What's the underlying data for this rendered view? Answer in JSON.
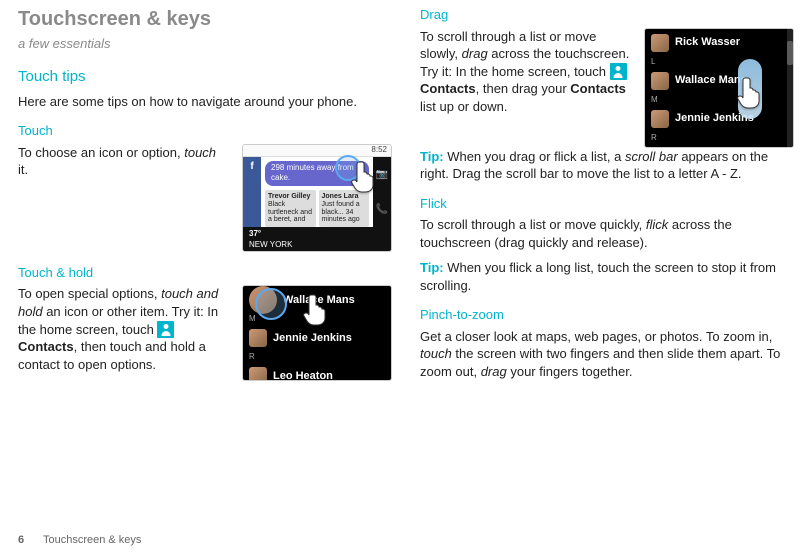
{
  "page_number": "6",
  "footer_title": "Touchscreen & keys",
  "left": {
    "heading": "Touchscreen & keys",
    "subtitle": "a few essentials",
    "touch_tips": {
      "title": "Touch tips",
      "intro": "Here are some tips on how to navigate around your phone."
    },
    "touch": {
      "title": "Touch",
      "p1a": "To choose an icon or option, ",
      "p1b": "touch",
      "p1c": " it."
    },
    "touch_hold": {
      "title": "Touch & hold",
      "p1a": "To open special options, ",
      "p1b": "touch and hold",
      "p1c": " an icon or other item. Try it: In the home screen, touch ",
      "contacts_label": "Contacts",
      "p1d": ", then touch and hold a contact to open options."
    }
  },
  "right": {
    "drag": {
      "title": "Drag",
      "p1a": "To scroll through a list or move slowly, ",
      "p1b": "drag",
      "p1c": " across the touchscreen. Try it: In the home screen, touch ",
      "contacts_label": "Contacts",
      "p1d": ", then drag your ",
      "p1e": "Contacts",
      "p1f": " list up or down.",
      "tip_label": "Tip:",
      "tip_a": " When you drag or flick a list, a ",
      "tip_b": "scroll bar",
      "tip_c": " appears on the right. Drag the scroll bar to move the list to a letter A - Z."
    },
    "flick": {
      "title": "Flick",
      "p1a": "To scroll through a list or move quickly, ",
      "p1b": "flick",
      "p1c": " across the touchscreen (drag quickly and release).",
      "tip_label": "Tip:",
      "tip": " When you flick a long list, touch the screen to stop it from scrolling."
    },
    "pinch": {
      "title": "Pinch-to-zoom",
      "p1a": "Get a closer look at maps, web pages, or photos. To zoom in, ",
      "p1b": "touch",
      "p1c": " the screen with two fingers and then slide them apart. To zoom out, ",
      "p1d": "drag",
      "p1e": " your fingers together."
    }
  },
  "mock": {
    "status_time": "8:52",
    "feed_bubble": "298 minutes away from cake.",
    "card1_name": "Trevor Gilley",
    "card1_line": "Black turtleneck and a beret, and",
    "card2_name": "Jones Lara",
    "card2_line": "Just found a black... 34 minutes ago",
    "weather_a": "37°",
    "weather_b": "NEW YORK",
    "contacts": {
      "a": "Rick Wasser",
      "b": "Wallace Mans",
      "c": "Jennie Jenkins",
      "d": "Leo Heaton",
      "sepL": "L",
      "sepM": "M",
      "sepR": "R"
    }
  }
}
